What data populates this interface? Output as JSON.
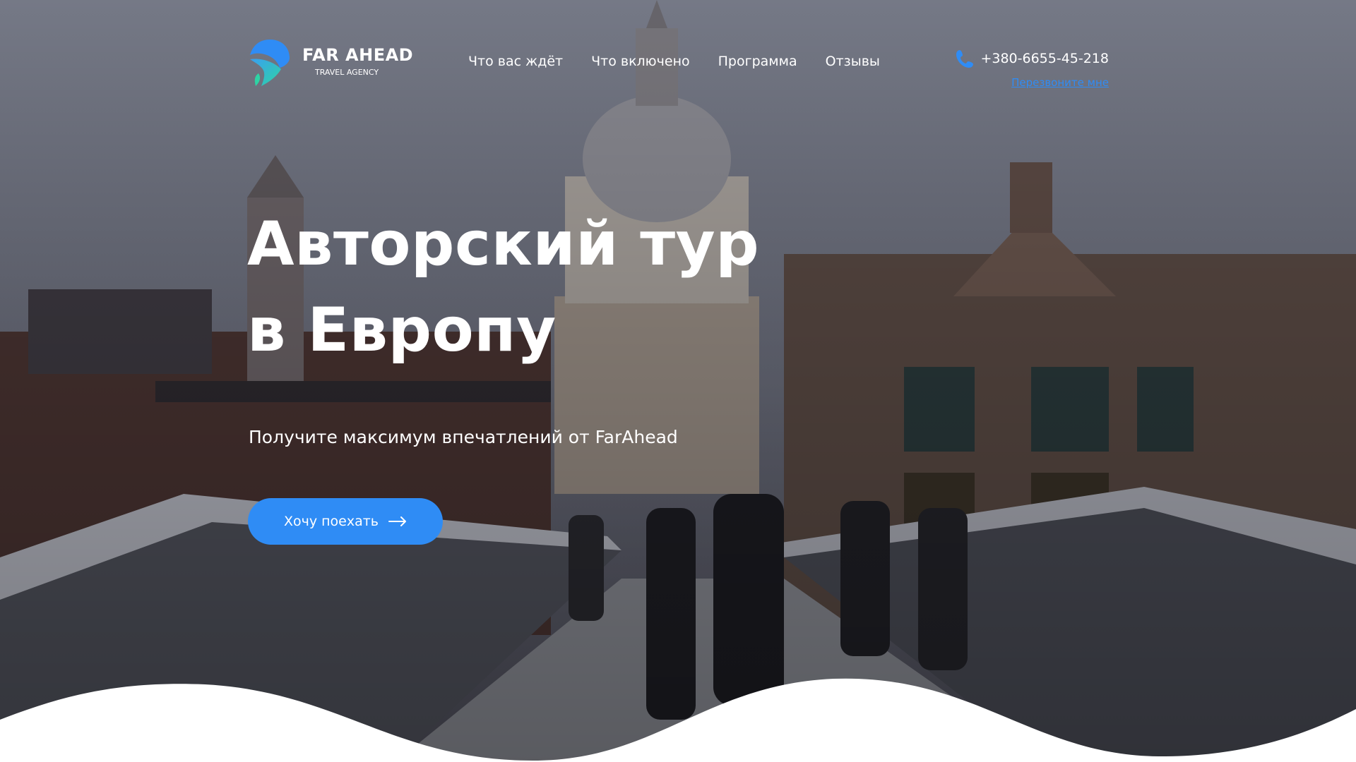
{
  "brand": {
    "name": "FAR AHEAD",
    "tagline": "TRAVEL AGENCY"
  },
  "nav": {
    "items": [
      {
        "label": "Что вас ждёт"
      },
      {
        "label": "Что включено"
      },
      {
        "label": "Программа"
      },
      {
        "label": "Отзывы"
      }
    ]
  },
  "contact": {
    "phone": "+380-6655-45-218",
    "phone_icon": "phone-icon",
    "callback_label": "Перезвоните мне"
  },
  "hero": {
    "title_line1": "Авторский тур",
    "title_line2": "в Европу",
    "subtitle": "Получите максимум впечатлений от FarAhead",
    "cta_label": "Хочу поехать",
    "cta_icon": "arrow-right-icon",
    "background_image": "photo-london-millennium-bridge-st-pauls"
  },
  "colors": {
    "accent": "#2f8cf5",
    "overlay": "#3a3a48",
    "text": "#ffffff"
  }
}
